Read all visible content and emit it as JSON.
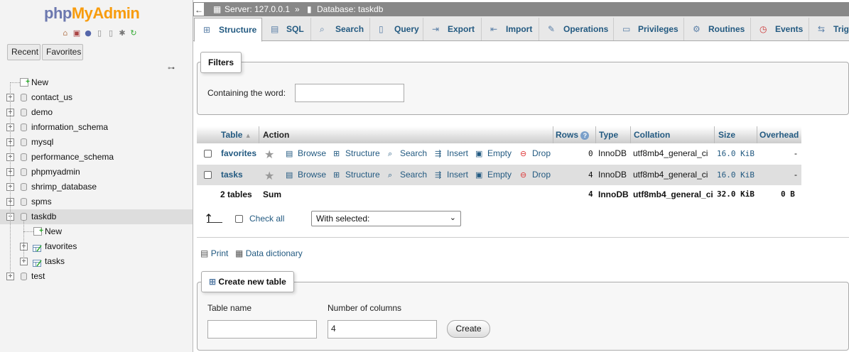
{
  "nav": {
    "logo_php": "php",
    "logo_myadmin": "MyAdmin",
    "recent_label": "Recent",
    "favorites_label": "Favorites",
    "tree": [
      {
        "label": "New",
        "type": "new"
      },
      {
        "label": "contact_us",
        "type": "db"
      },
      {
        "label": "demo",
        "type": "db"
      },
      {
        "label": "information_schema",
        "type": "db"
      },
      {
        "label": "mysql",
        "type": "db"
      },
      {
        "label": "performance_schema",
        "type": "db"
      },
      {
        "label": "phpmyadmin",
        "type": "db"
      },
      {
        "label": "shrimp_database",
        "type": "db"
      },
      {
        "label": "spms",
        "type": "db"
      },
      {
        "label": "taskdb",
        "type": "db",
        "expanded": true,
        "selected": true
      },
      {
        "label": "New",
        "type": "new",
        "child": true
      },
      {
        "label": "favorites",
        "type": "table",
        "child": true
      },
      {
        "label": "tasks",
        "type": "table",
        "child": true
      },
      {
        "label": "test",
        "type": "db"
      }
    ]
  },
  "topbar": {
    "server": "Server: 127.0.0.1",
    "separator": "»",
    "database": "Database: taskdb"
  },
  "tabs": [
    {
      "label": "Structure",
      "icon": "structure-icon"
    },
    {
      "label": "SQL",
      "icon": "sql-icon"
    },
    {
      "label": "Search",
      "icon": "search-icon"
    },
    {
      "label": "Query",
      "icon": "query-icon"
    },
    {
      "label": "Export",
      "icon": "export-icon"
    },
    {
      "label": "Import",
      "icon": "import-icon"
    },
    {
      "label": "Operations",
      "icon": "wrench-icon"
    },
    {
      "label": "Privileges",
      "icon": "privileges-icon"
    },
    {
      "label": "Routines",
      "icon": "routines-icon"
    },
    {
      "label": "Events",
      "icon": "clock-icon"
    },
    {
      "label": "Trig",
      "icon": "triggers-icon"
    }
  ],
  "filters": {
    "legend": "Filters",
    "containing_label": "Containing the word:",
    "value": ""
  },
  "table": {
    "headers": {
      "table": "Table",
      "action": "Action",
      "rows": "Rows",
      "type": "Type",
      "collation": "Collation",
      "size": "Size",
      "overhead": "Overhead"
    },
    "actions": [
      "Browse",
      "Structure",
      "Search",
      "Insert",
      "Empty",
      "Drop"
    ],
    "rows": [
      {
        "name": "favorites",
        "rows": "0",
        "type": "InnoDB",
        "collation": "utf8mb4_general_ci",
        "size": "16.0 KiB",
        "overhead": "-"
      },
      {
        "name": "tasks",
        "rows": "4",
        "type": "InnoDB",
        "collation": "utf8mb4_general_ci",
        "size": "16.0 KiB",
        "overhead": "-"
      }
    ],
    "summary": {
      "name": "2 tables",
      "action": "Sum",
      "rows": "4",
      "type": "InnoDB",
      "collation": "utf8mb4_general_ci",
      "size": "32.0 KiB",
      "overhead": "0 B"
    }
  },
  "bulk": {
    "check_all": "Check all",
    "with_selected": "With selected:"
  },
  "links": {
    "print": "Print",
    "data_dictionary": "Data dictionary"
  },
  "create": {
    "legend": "Create new table",
    "table_name_label": "Table name",
    "table_name_value": "",
    "columns_label": "Number of columns",
    "columns_value": "4",
    "button": "Create"
  }
}
